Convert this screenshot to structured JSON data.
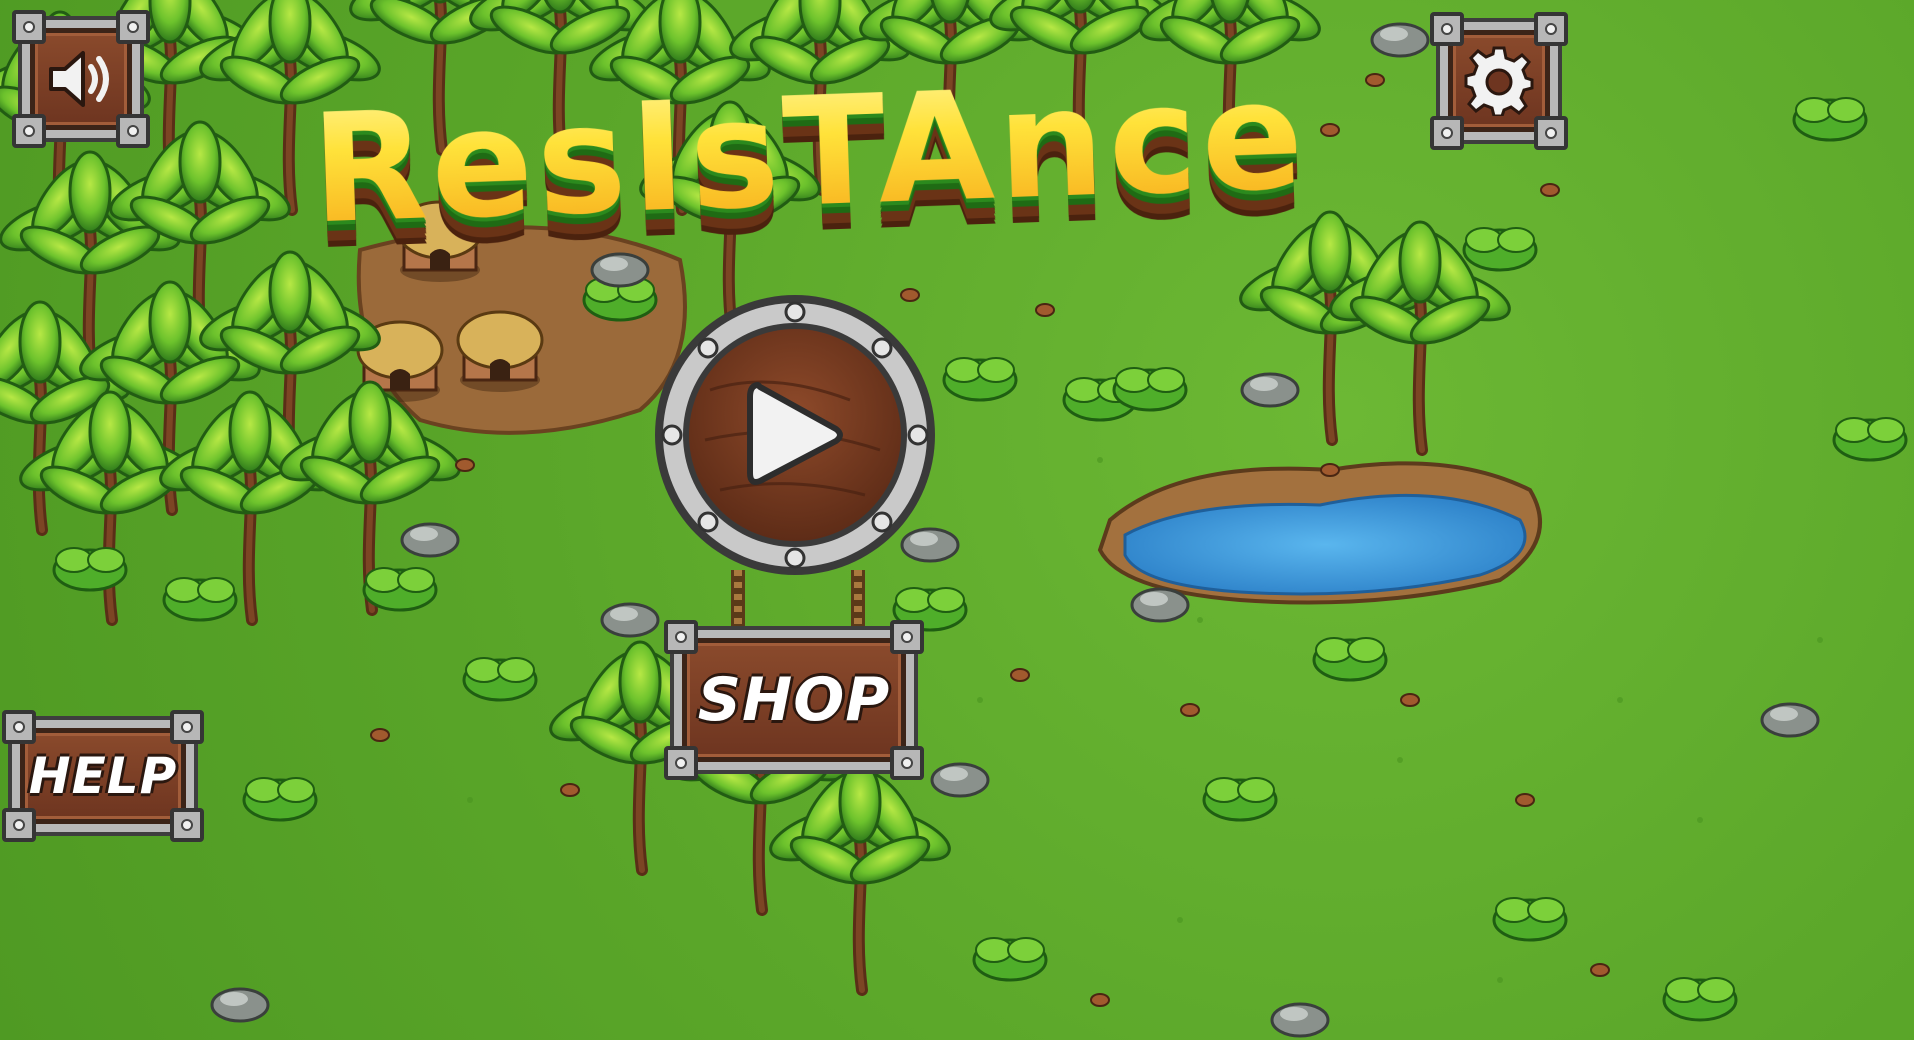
{
  "title": "ResIsTAnce",
  "buttons": {
    "sound": {
      "icon": "speaker-icon"
    },
    "settings": {
      "icon": "gear-icon"
    },
    "play": {
      "icon": "play-icon"
    },
    "help": {
      "label": "HELP"
    },
    "shop": {
      "label": "SHOP"
    }
  },
  "colors": {
    "grass": "#5aa629",
    "wood": "#7a3f24",
    "metal": "#b9b9b9",
    "title_yellow": "#ffe23a",
    "title_green": "#2b8a1d",
    "title_brown": "#6a3316",
    "water": "#3d9ee0"
  }
}
